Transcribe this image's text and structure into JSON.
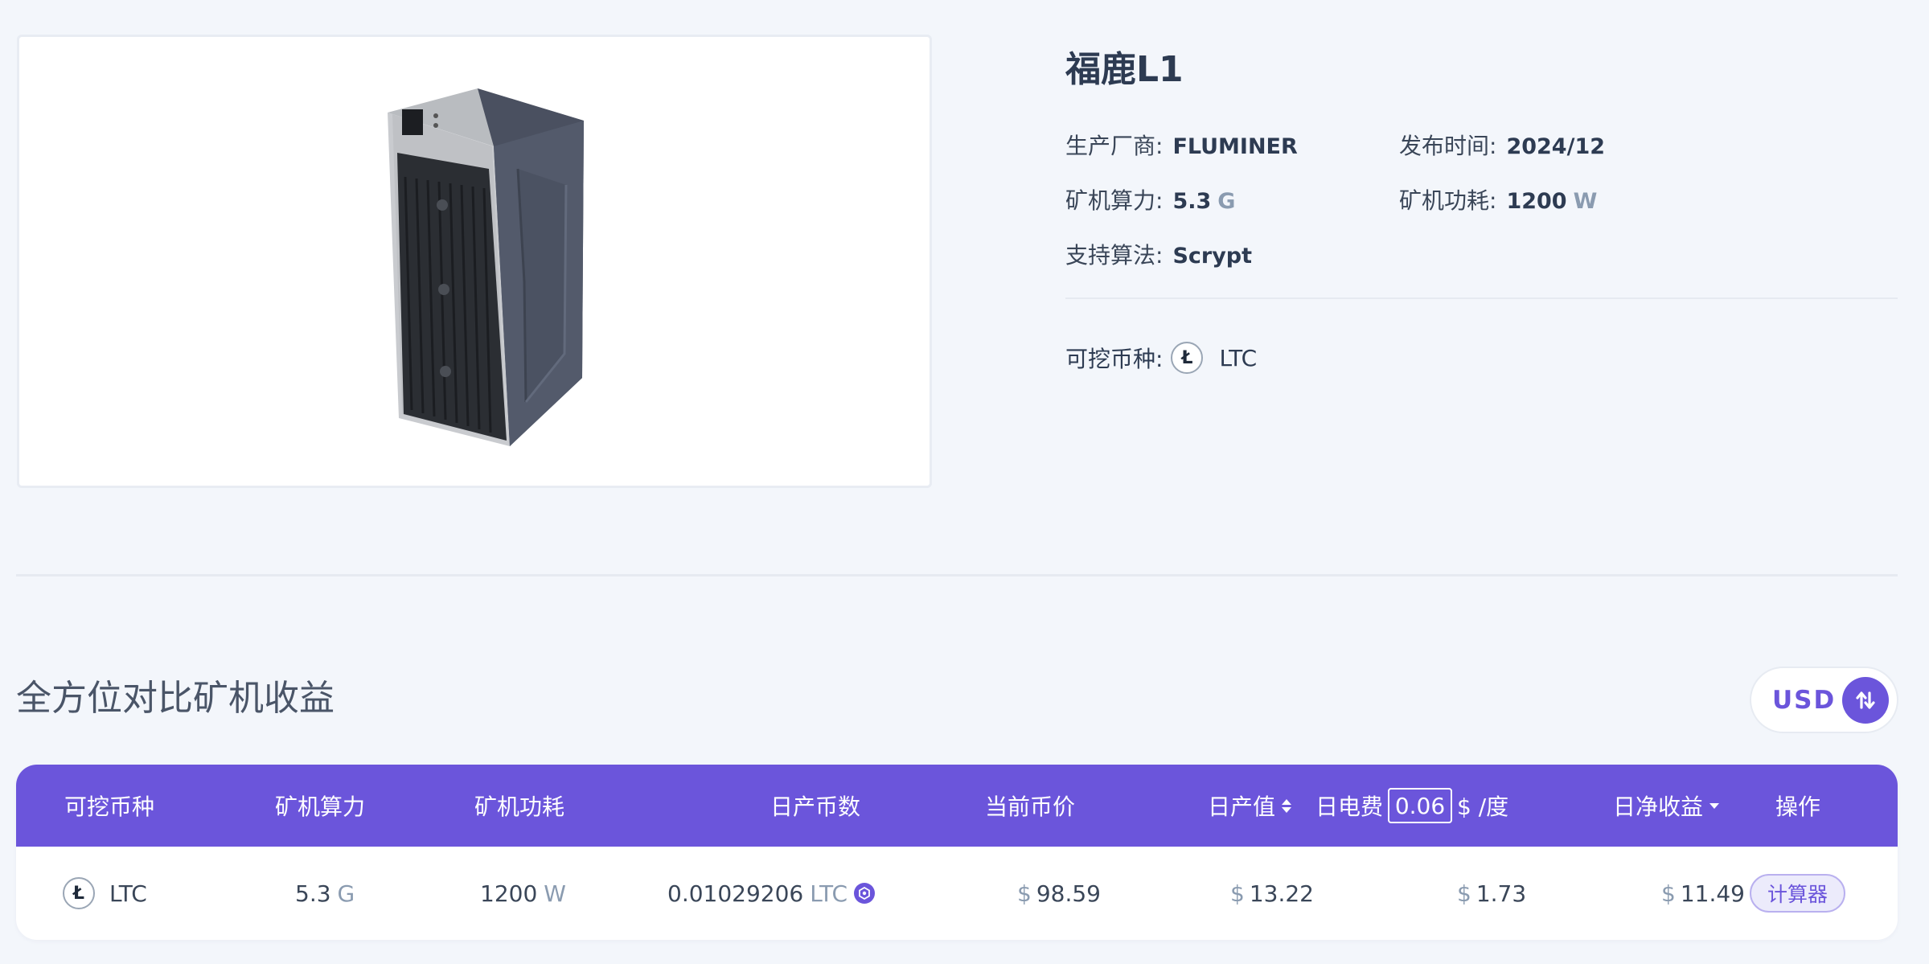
{
  "product": {
    "title": "福鹿L1",
    "specs": {
      "manufacturer_label": "生产厂商:",
      "manufacturer": "FLUMINER",
      "release_label": "发布时间:",
      "release": "2024/12",
      "hashrate_label": "矿机算力:",
      "hashrate": "5.3",
      "hashrate_unit": "G",
      "power_label": "矿机功耗:",
      "power": "1200",
      "power_unit": "W",
      "algorithm_label": "支持算法:",
      "algorithm": "Scrypt"
    },
    "coins_label": "可挖币种:",
    "coin_icon": "Ł",
    "coin": "LTC"
  },
  "section": {
    "title": "全方位对比矿机收益"
  },
  "currency": {
    "label": "USD"
  },
  "table": {
    "headers": {
      "coin": "可挖币种",
      "hashrate": "矿机算力",
      "power": "矿机功耗",
      "daily_coins": "日产币数",
      "price": "当前币价",
      "daily_output": "日产值",
      "daily_fee": "日电费",
      "fee_value": "0.06",
      "fee_unit": "$ /度",
      "daily_net": "日净收益",
      "action": "操作"
    },
    "rows": [
      {
        "coin_icon": "Ł",
        "coin": "LTC",
        "hashrate": "5.3",
        "hashrate_unit": "G",
        "power": "1200",
        "power_unit": "W",
        "daily_coins": "0.01029206",
        "daily_coins_unit": "LTC",
        "currency_symbol": "$",
        "price": "98.59",
        "daily_output": "13.22",
        "daily_fee": "1.73",
        "daily_net": "11.49",
        "action_label": "计算器"
      }
    ]
  },
  "colors": {
    "accent": "#6b55db",
    "background": "#f3f6fb"
  }
}
